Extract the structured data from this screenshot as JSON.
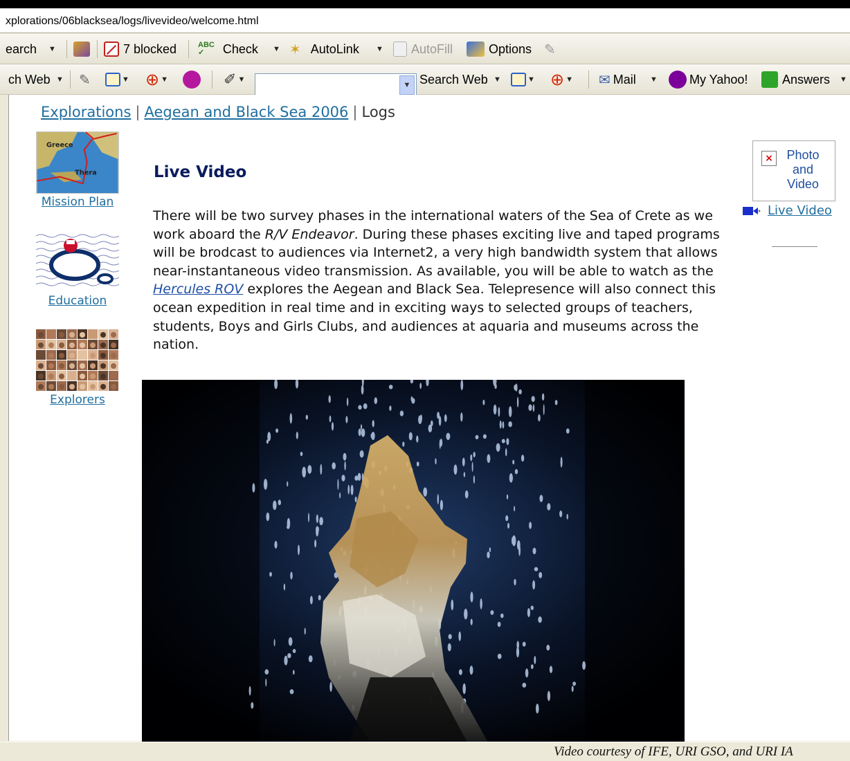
{
  "address": {
    "url": "xplorations/06blacksea/logs/livevideo/welcome.html"
  },
  "toolbar1": {
    "search_label": "earch",
    "blocked_label": "7 blocked",
    "check_label": "Check",
    "autolink_label": "AutoLink",
    "autofill_label": "AutoFill",
    "options_label": "Options"
  },
  "toolbar2": {
    "search_web_left": "ch Web",
    "search_input_value": "",
    "search_web_button": "Search Web",
    "mail_label": "Mail",
    "my_yahoo_label": "My Yahoo!",
    "answers_label": "Answers"
  },
  "breadcrumb": {
    "explorations": "Explorations",
    "sep1": "|",
    "expedition": "Aegean and Black Sea 2006",
    "sep2": "|",
    "current": "Logs"
  },
  "sidebar": {
    "mission_plan": "Mission Plan",
    "education": "Education",
    "explorers": "Explorers",
    "map_label_greece": "Greece",
    "map_label_thera": "Thera"
  },
  "main": {
    "title": "Live Video",
    "para_1": "There will be two survey phases in the international waters of the Sea of Crete as we work aboard the ",
    "vessel": "R/V Endeavor",
    "para_2": ". During these phases exciting live and taped programs will be brodcast to audiences via Internet2, a very high bandwidth system that allows near-instantaneous video transmission. As available, you will be able to watch as the ",
    "rov_link": "Hercules ROV",
    "para_3": " explores the Aegean and Black Sea. Telepresence will also connect this ocean expedition in real time and in exciting ways to selected groups of teachers, students, Boys and Girls Clubs, and audiences at aquaria and museums across the nation."
  },
  "right_panel": {
    "broken_image_alt": "Photo and Video",
    "broken_image_mark": "×",
    "live_video_link": "Live Video"
  },
  "status": {
    "caption": "Video courtesy of IFE, URI GSO, and URI IA"
  },
  "colors": {
    "link": "#1f6e9f",
    "title": "#0a1b5e",
    "chrome": "#ece9d8"
  }
}
